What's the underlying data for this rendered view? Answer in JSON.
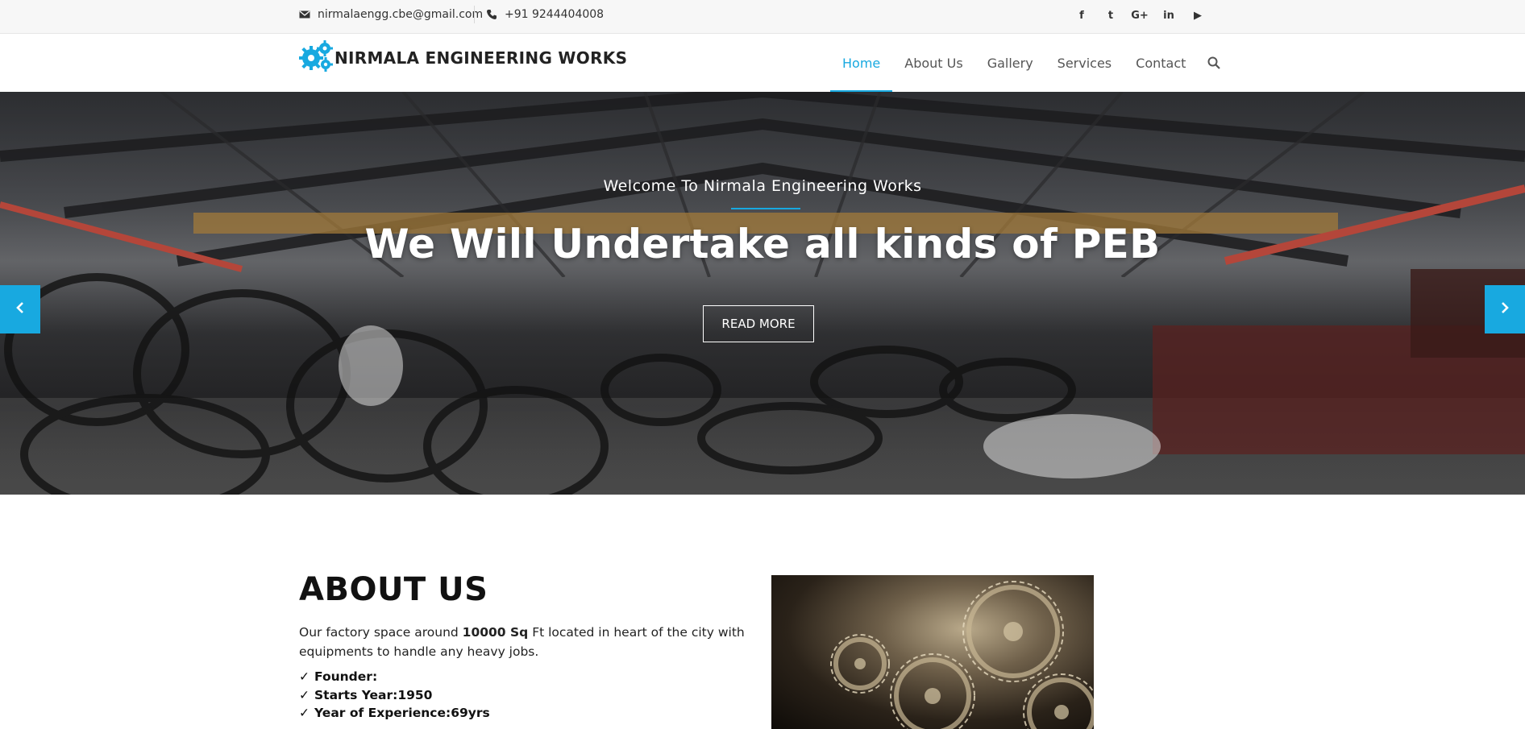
{
  "topbar": {
    "email": "nirmalaengg.cbe@gmail.com",
    "phone": "+91 9244404008",
    "email_icon": "envelope-icon",
    "phone_icon": "phone-icon",
    "social": [
      {
        "name": "facebook-icon",
        "glyph": "f"
      },
      {
        "name": "twitter-icon",
        "glyph": "t"
      },
      {
        "name": "google-plus-icon",
        "glyph": "G+"
      },
      {
        "name": "linkedin-icon",
        "glyph": "in"
      },
      {
        "name": "youtube-icon",
        "glyph": "▶"
      }
    ]
  },
  "header": {
    "brand": "NIRMALA ENGINEERING WORKS",
    "logo_icon": "gears-icon",
    "nav": [
      {
        "label": "Home",
        "active": true
      },
      {
        "label": "About Us",
        "active": false
      },
      {
        "label": "Gallery",
        "active": false
      },
      {
        "label": "Services",
        "active": false
      },
      {
        "label": "Contact",
        "active": false
      }
    ],
    "search_icon": "search-icon"
  },
  "hero": {
    "subtitle": "Welcome To Nirmala Engineering Works",
    "title": "We Will Undertake all kinds of PEB",
    "button": "READ MORE",
    "prev_icon": "chevron-left-icon",
    "next_icon": "chevron-right-icon"
  },
  "about": {
    "title": "ABOUT US",
    "text_before": "Our factory space around ",
    "text_bold": "10000 Sq",
    "text_after": " Ft located in heart of the city with equipments to handle any heavy jobs.",
    "facts": [
      {
        "label": "Founder",
        "value": ""
      },
      {
        "label": "Starts Year",
        "value": "1950"
      },
      {
        "label": "Year of Experience",
        "value": "69yrs"
      }
    ]
  },
  "colors": {
    "accent": "#18a9e0",
    "text": "#333333",
    "topbar_bg": "#f7f7f7"
  }
}
